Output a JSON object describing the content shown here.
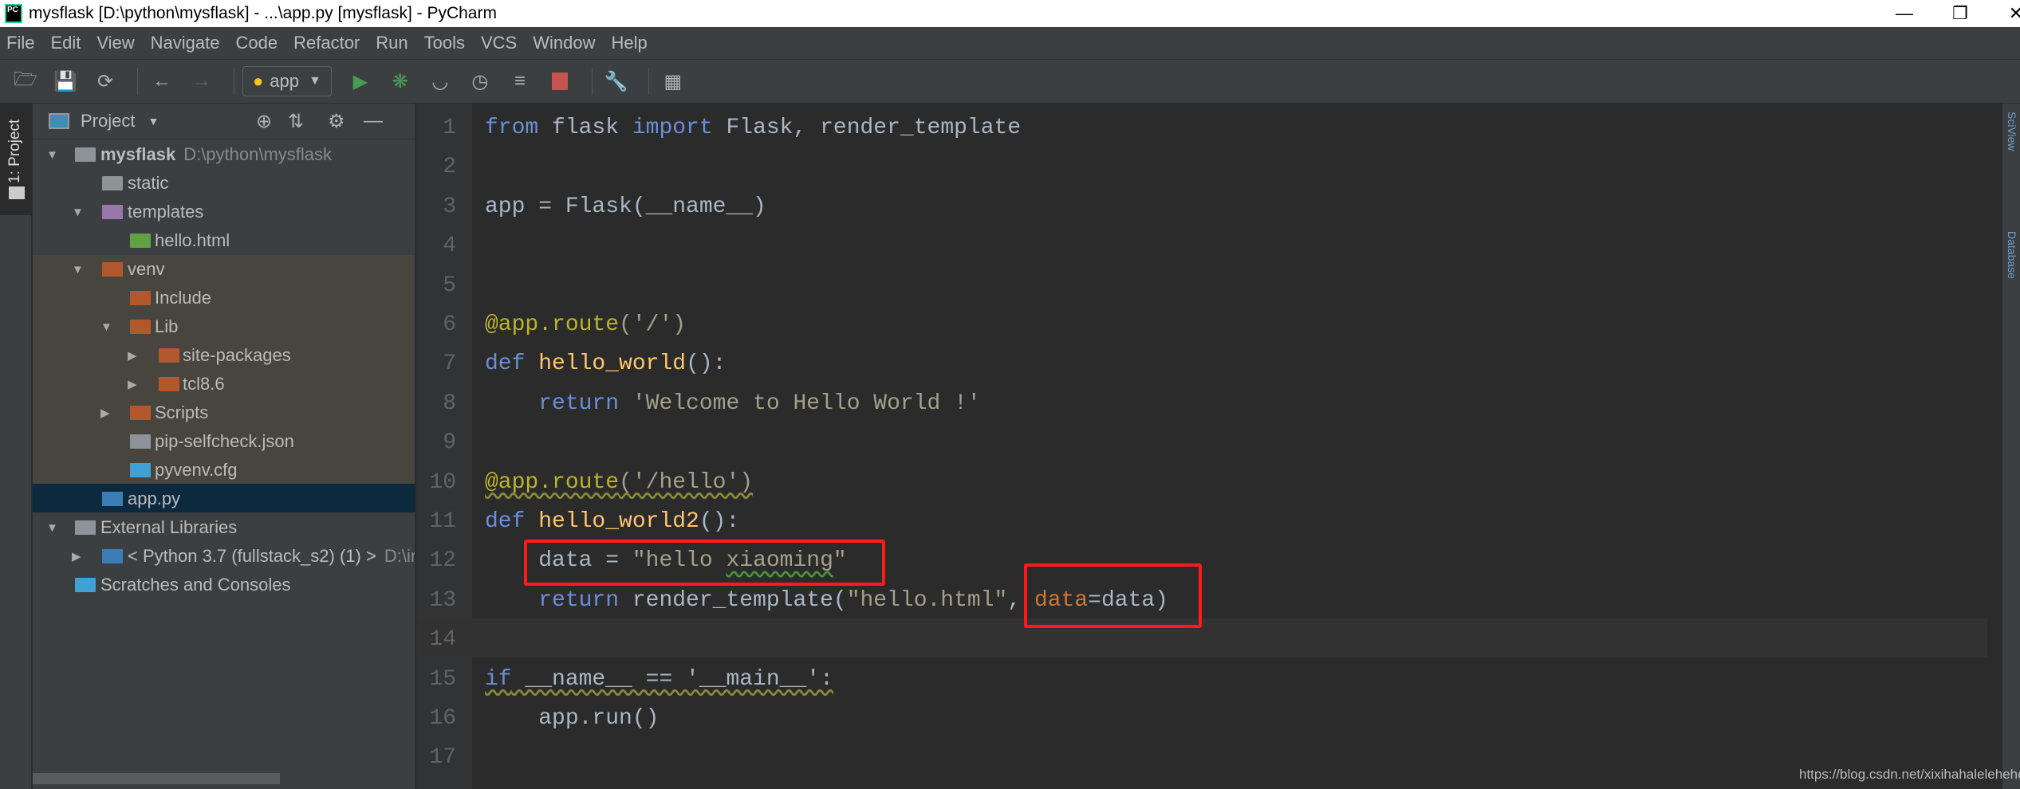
{
  "window": {
    "title": "mysflask [D:\\python\\mysflask] - ...\\app.py [mysflask] - PyCharm",
    "logo": "PC"
  },
  "menu": [
    "File",
    "Edit",
    "View",
    "Navigate",
    "Code",
    "Refactor",
    "Run",
    "Tools",
    "VCS",
    "Window",
    "Help"
  ],
  "toolbar": {
    "run_config": "app",
    "icons": [
      "open-folder-icon",
      "save-icon",
      "sync-icon",
      "back-icon",
      "forward-icon",
      "run-icon",
      "debug-icon",
      "coverage-icon",
      "profile-icon",
      "concurrency-icon",
      "stop-icon",
      "settings-wrench-icon",
      "sdk-icon"
    ]
  },
  "left_tab": "1: Project",
  "project": {
    "header": "Project",
    "tree": [
      {
        "label": "mysflask",
        "hint": "D:\\python\\mysflask",
        "level": 0,
        "arrow": "down",
        "icon": "folder",
        "bold": true
      },
      {
        "label": "static",
        "level": 1,
        "arrow": "",
        "icon": "folder-static"
      },
      {
        "label": "templates",
        "level": 1,
        "arrow": "down",
        "icon": "folder-templates"
      },
      {
        "label": "hello.html",
        "level": 2,
        "arrow": "",
        "icon": "html-file"
      },
      {
        "label": "venv",
        "level": 1,
        "arrow": "down",
        "icon": "folder-excluded"
      },
      {
        "label": "Include",
        "level": 2,
        "arrow": "",
        "icon": "folder-excluded"
      },
      {
        "label": "Lib",
        "level": 2,
        "arrow": "down",
        "icon": "folder-excluded"
      },
      {
        "label": "site-packages",
        "level": 3,
        "arrow": "right",
        "icon": "folder-excluded"
      },
      {
        "label": "tcl8.6",
        "level": 3,
        "arrow": "right",
        "icon": "folder-excluded"
      },
      {
        "label": "Scripts",
        "level": 2,
        "arrow": "right",
        "icon": "folder-excluded"
      },
      {
        "label": "pip-selfcheck.json",
        "level": 2,
        "arrow": "",
        "icon": "json-file"
      },
      {
        "label": "pyvenv.cfg",
        "level": 2,
        "arrow": "",
        "icon": "cfg-file"
      },
      {
        "label": "app.py",
        "level": 1,
        "arrow": "",
        "icon": "python-file",
        "selected": true
      },
      {
        "label": "External Libraries",
        "level": 0,
        "arrow": "down",
        "icon": "libraries"
      },
      {
        "label": "< Python 3.7 (fullstack_s2) (1) >",
        "hint": "D:\\ir",
        "level": 1,
        "arrow": "right",
        "icon": "python"
      },
      {
        "label": "Scratches and Consoles",
        "level": 0,
        "arrow": "",
        "icon": "scratches"
      }
    ]
  },
  "editor": {
    "current_line": 14,
    "lines": [
      [
        {
          "t": "from",
          "c": "kw"
        },
        {
          "t": " flask ",
          "c": "pl"
        },
        {
          "t": "import",
          "c": "kw"
        },
        {
          "t": " Flask, render_template",
          "c": "pl"
        }
      ],
      [],
      [
        {
          "t": "app = Flask(__name__)",
          "c": "pl"
        }
      ],
      [],
      [],
      [
        {
          "t": "@app.route",
          "c": "deco"
        },
        {
          "t": "('/')",
          "c": "str"
        }
      ],
      [
        {
          "t": "def ",
          "c": "kw"
        },
        {
          "t": "hello_world",
          "c": "fn"
        },
        {
          "t": "():",
          "c": "pl"
        }
      ],
      [
        {
          "t": "    "
        },
        {
          "t": "return ",
          "c": "kw"
        },
        {
          "t": "'Welcome to Hello World !'",
          "c": "str"
        }
      ],
      [],
      [
        {
          "t": "@app.route",
          "c": "deco squig"
        },
        {
          "t": "('/hello')",
          "c": "str squig"
        }
      ],
      [
        {
          "t": "def ",
          "c": "kw"
        },
        {
          "t": "hello_world2",
          "c": "fn"
        },
        {
          "t": "():",
          "c": "pl"
        }
      ],
      [
        {
          "t": "    "
        },
        {
          "t": "data = ",
          "c": "pl"
        },
        {
          "t": "\"hello ",
          "c": "str"
        },
        {
          "t": "xiaoming",
          "c": "str squigg"
        },
        {
          "t": "\"",
          "c": "str"
        }
      ],
      [
        {
          "t": "    "
        },
        {
          "t": "return ",
          "c": "kw"
        },
        {
          "t": "render_template(",
          "c": "pl"
        },
        {
          "t": "\"hello.html\"",
          "c": "str"
        },
        {
          "t": ", ",
          "c": "pl"
        },
        {
          "t": "data",
          "c": "par"
        },
        {
          "t": "=data)",
          "c": "pl"
        }
      ],
      [],
      [
        {
          "t": "if",
          "c": "kw squig"
        },
        {
          "t": " __name__ == '__main__':",
          "c": "pl squig"
        }
      ],
      [
        {
          "t": "    "
        },
        {
          "t": "app.run()",
          "c": "pl"
        }
      ],
      []
    ]
  },
  "right_tabs": [
    "SciView",
    "Database"
  ],
  "watermark": "https://blog.csdn.net/xixihahalelehehe",
  "colors": {
    "keyword": "#6a8fd8",
    "function": "#ffc66d",
    "string": "#a5a08a",
    "decorator": "#bbb529",
    "highlight_box": "#ff1a1a"
  }
}
